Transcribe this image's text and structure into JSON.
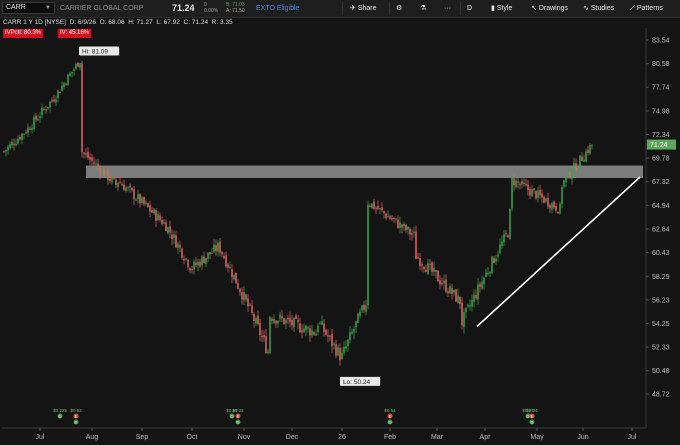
{
  "toolbar": {
    "symbol": "CARR",
    "company": "CARRIER GLOBAL CORP",
    "price": "71.24",
    "change": "0",
    "change_pct": "0.00%",
    "bid_label": "B: 71.03",
    "ask_label": "A: 71.50",
    "ext_label": "EXTO Eligible",
    "share": "Share",
    "interval": "D",
    "style": "Style",
    "drawings": "Drawings",
    "studies": "Studies",
    "patterns": "Patterns"
  },
  "info": {
    "title": "CARR 1 Y 1D [NYSE]",
    "date": "D: 6/9/26",
    "open": "O: 68.06",
    "high": "H: 71.27",
    "low": "L: 67.92",
    "close": "C: 71.24",
    "range": "R: 3.35",
    "ivp": "IVPctl: 80.3%",
    "iv": "IV: 45.16%"
  },
  "colors": {
    "up": "#3fa34d",
    "down": "#e06666",
    "background": "#141414",
    "zone": "#8e8e8e",
    "trendline": "#ffffff",
    "price_tag": "#5ba85a"
  },
  "chart_data": {
    "type": "candlestick",
    "title": "CARR 1 Y 1D [NYSE]",
    "ylim": [
      48.7,
      84.9
    ],
    "y_ticks": [
      48.72,
      50.48,
      52.33,
      54.25,
      56.23,
      58.29,
      60.43,
      62.64,
      64.94,
      67.32,
      69.78,
      72.34,
      74.98,
      77.74,
      80.58,
      83.54
    ],
    "x_ticks": [
      "Jul",
      "Aug",
      "Sep",
      "Oct",
      "Nov",
      "Dec",
      "26",
      "Feb",
      "Mar",
      "Apr",
      "May",
      "Jun",
      "Jul"
    ],
    "last_price_tag": "71.24",
    "annotations": [
      {
        "text": "Hi: 81.09",
        "value": 81.09,
        "date": "Jul"
      },
      {
        "text": "Lo: 50.24",
        "value": 50.24,
        "date": "Jan"
      }
    ],
    "resistance_zone": [
      67.7,
      69.0
    ],
    "trendline": {
      "from": {
        "date": "Apr",
        "value": 54.0
      },
      "to": {
        "date": "Jul",
        "value": 67.8
      }
    },
    "event_markers": [
      {
        "label": "$0.225",
        "date": "Jul",
        "kinds": [
          "D"
        ]
      },
      {
        "label": "$0.63",
        "date": "Jul",
        "kinds": [
          "E",
          "D"
        ]
      },
      {
        "label": "$0.67",
        "date": "Oct",
        "kinds": [
          "D"
        ]
      },
      {
        "label": "$0.22",
        "date": "Oct",
        "kinds": [
          "E",
          "D"
        ]
      },
      {
        "label": "$0.54",
        "date": "Feb",
        "kinds": [
          "E",
          "D"
        ]
      },
      {
        "label": "$0.57",
        "date": "Apr",
        "kinds": [
          "D"
        ]
      },
      {
        "label": "$0.24",
        "date": "May",
        "kinds": [
          "E",
          "D"
        ]
      }
    ],
    "anchor_path": [
      {
        "date": "Jul",
        "value": 70.5
      },
      {
        "date": "Jul",
        "value": 73.0
      },
      {
        "date": "Jul",
        "value": 76.5
      },
      {
        "date": "Jul",
        "value": 81.0
      },
      {
        "date": "Aug",
        "value": 72.0
      },
      {
        "date": "Aug",
        "value": 67.0
      },
      {
        "date": "Sep",
        "value": 67.5
      },
      {
        "date": "Sep",
        "value": 63.0
      },
      {
        "date": "Oct",
        "value": 59.0
      },
      {
        "date": "Nov",
        "value": 61.0
      },
      {
        "date": "Nov",
        "value": 52.0
      },
      {
        "date": "Dec",
        "value": 55.0
      },
      {
        "date": "Dec",
        "value": 53.5
      },
      {
        "date": "Jan",
        "value": 54.5
      },
      {
        "date": "Jan",
        "value": 51.5
      },
      {
        "date": "Jan",
        "value": 56.0
      },
      {
        "date": "Feb",
        "value": 65.5
      },
      {
        "date": "Feb",
        "value": 62.0
      },
      {
        "date": "Mar",
        "value": 60.5
      },
      {
        "date": "Mar",
        "value": 56.0
      },
      {
        "date": "Apr",
        "value": 54.0
      },
      {
        "date": "Apr",
        "value": 62.5
      },
      {
        "date": "May",
        "value": 67.5
      },
      {
        "date": "May",
        "value": 64.5
      },
      {
        "date": "Jun",
        "value": 66.5
      },
      {
        "date": "Jun",
        "value": 71.24
      }
    ]
  }
}
